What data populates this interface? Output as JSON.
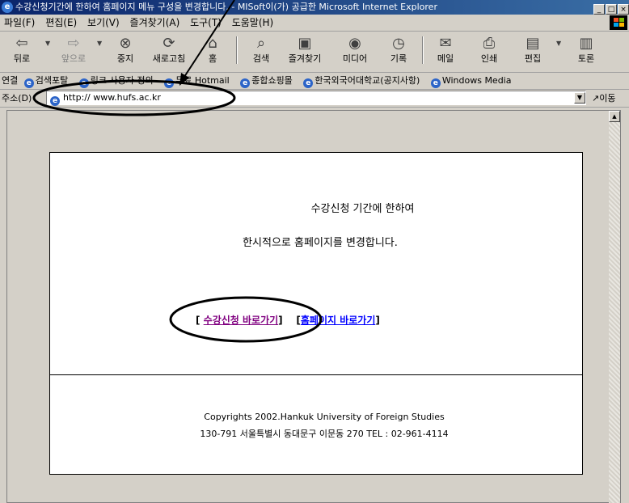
{
  "window": {
    "title": "수강신청기간에 한하여 홈페이지 메뉴 구성을 변경합니다. - MISoft이(가) 공급한 Microsoft Internet Explorer",
    "controls": [
      "_",
      "□",
      "×"
    ]
  },
  "menu": {
    "items": [
      "파일(F)",
      "편집(E)",
      "보기(V)",
      "즐겨찾기(A)",
      "도구(T)",
      "도움말(H)"
    ]
  },
  "toolbar": {
    "back": "뒤로",
    "forward": "앞으로",
    "stop": "중지",
    "refresh": "새로고침",
    "home": "홈",
    "search": "검색",
    "favorites": "즐겨찾기",
    "media": "미디어",
    "history": "기록",
    "mail": "메일",
    "print": "인쇄",
    "edit": "편집",
    "discuss": "토론"
  },
  "links_bar": {
    "label": "연결",
    "items": [
      "검색포탈",
      "링크 사용자 정의",
      "무료 Hotmail",
      "종합쇼핑몰",
      "한국외국어대학교(공지사항)",
      "Windows Media"
    ]
  },
  "address_bar": {
    "label": "주소(D)",
    "url": "http:// www.hufs.ac.kr",
    "go": "이동"
  },
  "notice": {
    "line1": "수강신청 기간에 한하여",
    "line2": "한시적으로 홈페이지를 변경합니다.",
    "course_link_open": "[",
    "course_link": "수강신청 바로가기",
    "course_link_close": "]",
    "home_link_open": "[",
    "home_link": "홈페이지 바로가기",
    "home_link_close": "]"
  },
  "footer": {
    "copyright": "Copyrights 2002.Hankuk University of Foreign Studies",
    "address": "130-791 서울특별시 동대문구 이문동 270 TEL : 02-961-4114"
  },
  "colors": {
    "titlebar_start": "#0a246a",
    "titlebar_end": "#3a6ea5",
    "chrome": "#d4d0c8",
    "visited_link": "#800080",
    "link": "#0000ff"
  }
}
